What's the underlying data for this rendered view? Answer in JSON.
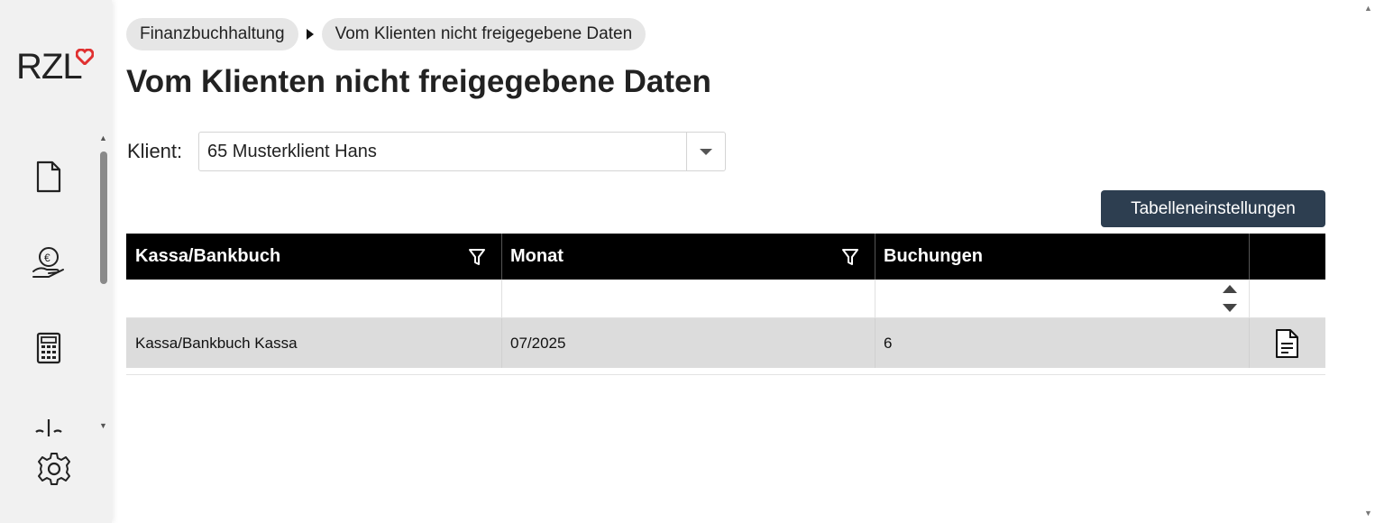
{
  "sidebar": {
    "logo": "RZL",
    "nav_items": [
      {
        "icon": "document-icon"
      },
      {
        "icon": "euro-hand-icon"
      },
      {
        "icon": "calculator-icon"
      },
      {
        "icon": "scale-icon"
      }
    ],
    "settings_icon": "gear-icon"
  },
  "breadcrumb": {
    "items": [
      "Finanzbuchhaltung",
      "Vom Klienten nicht freigegebene Daten"
    ]
  },
  "page": {
    "title": "Vom Klienten nicht freigegebene Daten"
  },
  "client": {
    "label": "Klient:",
    "value": "65 Musterklient Hans"
  },
  "toolbar": {
    "table_settings_label": "Tabelleneinstellungen"
  },
  "table": {
    "columns": [
      "Kassa/Bankbuch",
      "Monat",
      "Buchungen",
      ""
    ],
    "rows": [
      {
        "kassa": "Kassa/Bankbuch Kassa",
        "monat": "07/2025",
        "buchungen": "6",
        "action_icon": "document-icon"
      }
    ]
  },
  "colors": {
    "header_bg": "#000000",
    "button_bg": "#2d3e50",
    "logo_accent": "#e03030",
    "row_bg": "#dcdcdc"
  }
}
